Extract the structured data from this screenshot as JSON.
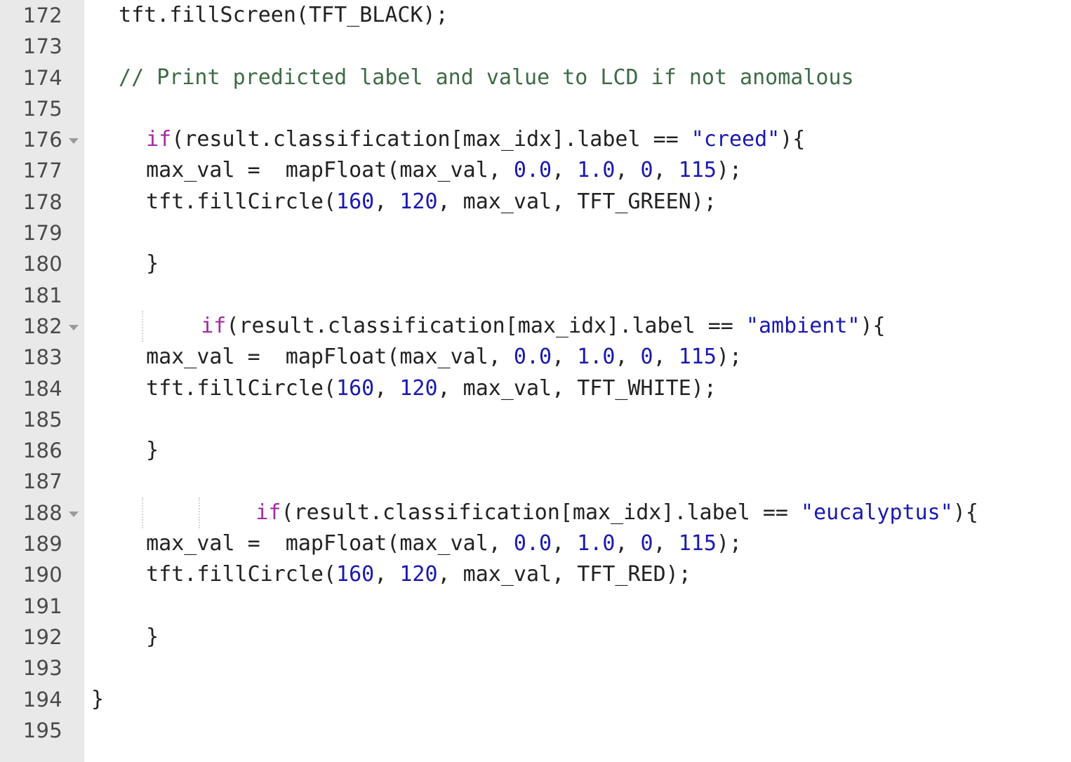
{
  "editor": {
    "language": "cpp",
    "gutter_background": "#e9e9e9",
    "code_background": "#ffffff",
    "first_line": 172,
    "last_line": 195,
    "colors": {
      "keyword": "#a32ca3",
      "string": "#1a19b0",
      "number": "#1a19b0",
      "comment": "#3d6b45",
      "operator": "#bfc4cc",
      "plain": "#222222",
      "line_number": "#4a4a4a",
      "fold_arrow": "#9a9a9a",
      "indent_guide": "#d5d5d5"
    },
    "fold_arrow_icon": "chevron-down-icon",
    "lines": [
      {
        "number": "172",
        "foldable": false,
        "indent_guides": 0,
        "indent": 2,
        "tokens": [
          {
            "text": "tft.fillScreen(TFT_BLACK);",
            "type": "plain"
          }
        ]
      },
      {
        "number": "173",
        "foldable": false,
        "indent_guides": 0,
        "indent": 0,
        "tokens": []
      },
      {
        "number": "174",
        "foldable": false,
        "indent_guides": 0,
        "indent": 2,
        "tokens": [
          {
            "text": "// Print predicted label and value to LCD if not anomalous",
            "type": "comment"
          }
        ]
      },
      {
        "number": "175",
        "foldable": false,
        "indent_guides": 0,
        "indent": 0,
        "tokens": []
      },
      {
        "number": "176",
        "foldable": true,
        "indent_guides": 0,
        "indent": 4,
        "tokens": [
          {
            "text": "if",
            "type": "keyword"
          },
          {
            "text": "(result.classification[max_idx].label ",
            "type": "plain"
          },
          {
            "text": "==",
            "type": "operator"
          },
          {
            "text": " ",
            "type": "plain"
          },
          {
            "text": "\"creed\"",
            "type": "string"
          },
          {
            "text": "){",
            "type": "plain"
          }
        ]
      },
      {
        "number": "177",
        "foldable": false,
        "indent_guides": 0,
        "indent": 4,
        "tokens": [
          {
            "text": "max_val ",
            "type": "plain"
          },
          {
            "text": "=",
            "type": "operator"
          },
          {
            "text": "  mapFloat(max_val, ",
            "type": "plain"
          },
          {
            "text": "0.0",
            "type": "number"
          },
          {
            "text": ", ",
            "type": "plain"
          },
          {
            "text": "1.0",
            "type": "number"
          },
          {
            "text": ", ",
            "type": "plain"
          },
          {
            "text": "0",
            "type": "number"
          },
          {
            "text": ", ",
            "type": "plain"
          },
          {
            "text": "115",
            "type": "number"
          },
          {
            "text": ");",
            "type": "plain"
          }
        ]
      },
      {
        "number": "178",
        "foldable": false,
        "indent_guides": 0,
        "indent": 4,
        "tokens": [
          {
            "text": "tft.fillCircle(",
            "type": "plain"
          },
          {
            "text": "160",
            "type": "number"
          },
          {
            "text": ", ",
            "type": "plain"
          },
          {
            "text": "120",
            "type": "number"
          },
          {
            "text": ", max_val, TFT_GREEN);",
            "type": "plain"
          }
        ]
      },
      {
        "number": "179",
        "foldable": false,
        "indent_guides": 0,
        "indent": 0,
        "tokens": []
      },
      {
        "number": "180",
        "foldable": false,
        "indent_guides": 0,
        "indent": 4,
        "tokens": [
          {
            "text": "}",
            "type": "plain"
          }
        ]
      },
      {
        "number": "181",
        "foldable": false,
        "indent_guides": 0,
        "indent": 0,
        "tokens": []
      },
      {
        "number": "182",
        "foldable": true,
        "indent_guides": 1,
        "indent": 8,
        "tokens": [
          {
            "text": "if",
            "type": "keyword"
          },
          {
            "text": "(result.classification[max_idx].label ",
            "type": "plain"
          },
          {
            "text": "==",
            "type": "operator"
          },
          {
            "text": " ",
            "type": "plain"
          },
          {
            "text": "\"ambient\"",
            "type": "string"
          },
          {
            "text": "){",
            "type": "plain"
          }
        ]
      },
      {
        "number": "183",
        "foldable": false,
        "indent_guides": 0,
        "indent": 4,
        "tokens": [
          {
            "text": "max_val ",
            "type": "plain"
          },
          {
            "text": "=",
            "type": "operator"
          },
          {
            "text": "  mapFloat(max_val, ",
            "type": "plain"
          },
          {
            "text": "0.0",
            "type": "number"
          },
          {
            "text": ", ",
            "type": "plain"
          },
          {
            "text": "1.0",
            "type": "number"
          },
          {
            "text": ", ",
            "type": "plain"
          },
          {
            "text": "0",
            "type": "number"
          },
          {
            "text": ", ",
            "type": "plain"
          },
          {
            "text": "115",
            "type": "number"
          },
          {
            "text": ");",
            "type": "plain"
          }
        ]
      },
      {
        "number": "184",
        "foldable": false,
        "indent_guides": 0,
        "indent": 4,
        "tokens": [
          {
            "text": "tft.fillCircle(",
            "type": "plain"
          },
          {
            "text": "160",
            "type": "number"
          },
          {
            "text": ", ",
            "type": "plain"
          },
          {
            "text": "120",
            "type": "number"
          },
          {
            "text": ", max_val, TFT_WHITE);",
            "type": "plain"
          }
        ]
      },
      {
        "number": "185",
        "foldable": false,
        "indent_guides": 0,
        "indent": 0,
        "tokens": []
      },
      {
        "number": "186",
        "foldable": false,
        "indent_guides": 0,
        "indent": 4,
        "tokens": [
          {
            "text": "}",
            "type": "plain"
          }
        ]
      },
      {
        "number": "187",
        "foldable": false,
        "indent_guides": 0,
        "indent": 0,
        "tokens": []
      },
      {
        "number": "188",
        "foldable": true,
        "indent_guides": 2,
        "indent": 12,
        "tokens": [
          {
            "text": "if",
            "type": "keyword"
          },
          {
            "text": "(result.classification[max_idx].label ",
            "type": "plain"
          },
          {
            "text": "==",
            "type": "operator"
          },
          {
            "text": " ",
            "type": "plain"
          },
          {
            "text": "\"eucalyptus\"",
            "type": "string"
          },
          {
            "text": "){",
            "type": "plain"
          }
        ]
      },
      {
        "number": "189",
        "foldable": false,
        "indent_guides": 0,
        "indent": 4,
        "tokens": [
          {
            "text": "max_val ",
            "type": "plain"
          },
          {
            "text": "=",
            "type": "operator"
          },
          {
            "text": "  mapFloat(max_val, ",
            "type": "plain"
          },
          {
            "text": "0.0",
            "type": "number"
          },
          {
            "text": ", ",
            "type": "plain"
          },
          {
            "text": "1.0",
            "type": "number"
          },
          {
            "text": ", ",
            "type": "plain"
          },
          {
            "text": "0",
            "type": "number"
          },
          {
            "text": ", ",
            "type": "plain"
          },
          {
            "text": "115",
            "type": "number"
          },
          {
            "text": ");",
            "type": "plain"
          }
        ]
      },
      {
        "number": "190",
        "foldable": false,
        "indent_guides": 0,
        "indent": 4,
        "tokens": [
          {
            "text": "tft.fillCircle(",
            "type": "plain"
          },
          {
            "text": "160",
            "type": "number"
          },
          {
            "text": ", ",
            "type": "plain"
          },
          {
            "text": "120",
            "type": "number"
          },
          {
            "text": ", max_val, TFT_RED);",
            "type": "plain"
          }
        ]
      },
      {
        "number": "191",
        "foldable": false,
        "indent_guides": 0,
        "indent": 0,
        "tokens": []
      },
      {
        "number": "192",
        "foldable": false,
        "indent_guides": 0,
        "indent": 4,
        "tokens": [
          {
            "text": "}",
            "type": "plain"
          }
        ]
      },
      {
        "number": "193",
        "foldable": false,
        "indent_guides": 0,
        "indent": 0,
        "tokens": []
      },
      {
        "number": "194",
        "foldable": false,
        "indent_guides": 0,
        "indent": 0,
        "tokens": [
          {
            "text": "}",
            "type": "plain"
          }
        ]
      },
      {
        "number": "195",
        "foldable": false,
        "indent_guides": 0,
        "indent": 0,
        "tokens": []
      }
    ]
  }
}
